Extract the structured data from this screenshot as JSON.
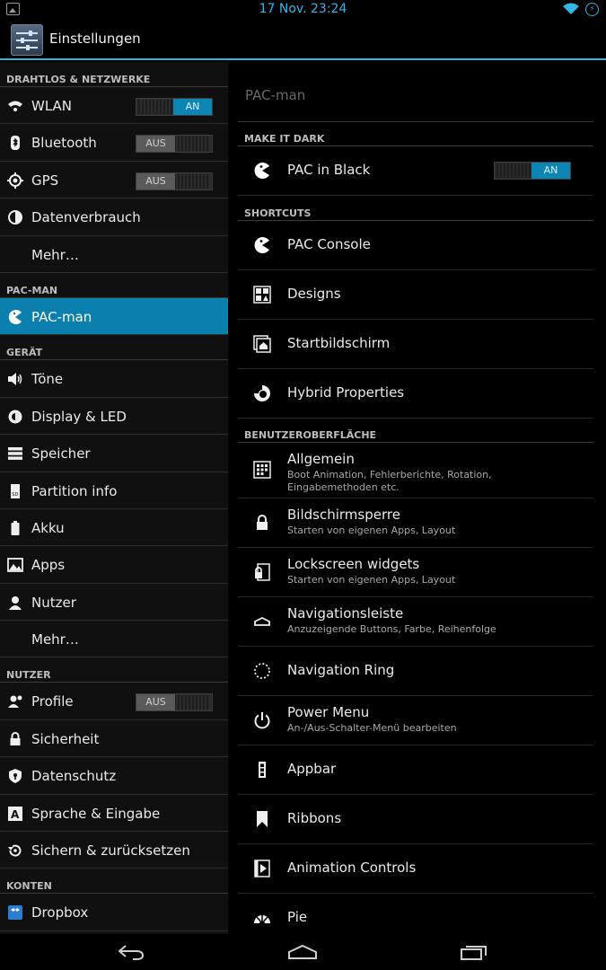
{
  "status_bar": {
    "time": "17 Nov. 23:24"
  },
  "action_bar": {
    "title": "Einstellungen"
  },
  "left": {
    "sections": {
      "wireless": "DRAHTLOS & NETZWERKE",
      "pacman": "PAC-MAN",
      "device": "GERÄT",
      "user": "NUTZER",
      "accounts": "KONTEN"
    },
    "items": {
      "wlan": {
        "label": "WLAN",
        "toggle": "AN"
      },
      "bluetooth": {
        "label": "Bluetooth",
        "toggle": "AUS"
      },
      "gps": {
        "label": "GPS",
        "toggle": "AUS"
      },
      "data_usage": {
        "label": "Datenverbrauch"
      },
      "more1": {
        "label": "Mehr…"
      },
      "pacman": {
        "label": "PAC-man"
      },
      "sounds": {
        "label": "Töne"
      },
      "display": {
        "label": "Display & LED"
      },
      "storage": {
        "label": "Speicher"
      },
      "partition": {
        "label": "Partition info"
      },
      "battery": {
        "label": "Akku"
      },
      "apps": {
        "label": "Apps"
      },
      "users": {
        "label": "Nutzer"
      },
      "more2": {
        "label": "Mehr…"
      },
      "profiles": {
        "label": "Profile",
        "toggle": "AUS"
      },
      "security": {
        "label": "Sicherheit"
      },
      "privacy": {
        "label": "Datenschutz"
      },
      "language": {
        "label": "Sprache & Eingabe"
      },
      "backup": {
        "label": "Sichern & zurücksetzen"
      },
      "dropbox": {
        "label": "Dropbox"
      }
    }
  },
  "right": {
    "title": "PAC-man",
    "sections": {
      "dark": "MAKE IT DARK",
      "shortcuts": "SHORTCUTS",
      "ui": "BENUTZEROBERFLÄCHE"
    },
    "items": {
      "pac_black": {
        "label": "PAC in Black",
        "toggle": "AN"
      },
      "pac_console": {
        "label": "PAC Console"
      },
      "designs": {
        "label": "Designs"
      },
      "homescreen": {
        "label": "Startbildschirm"
      },
      "hybrid": {
        "label": "Hybrid Properties"
      },
      "general": {
        "label": "Allgemein",
        "sub": "Boot Animation, Fehlerberichte, Rotation, Eingabemethoden etc."
      },
      "lockscreen": {
        "label": "Bildschirmsperre",
        "sub": "Starten von eigenen Apps, Layout"
      },
      "lock_widgets": {
        "label": "Lockscreen widgets",
        "sub": "Starten von eigenen Apps, Layout"
      },
      "navbar": {
        "label": "Navigationsleiste",
        "sub": "Anzuzeigende Buttons, Farbe, Reihenfolge"
      },
      "nav_ring": {
        "label": "Navigation Ring"
      },
      "power_menu": {
        "label": "Power Menu",
        "sub": "An-/Aus-Schalter-Menü bearbeiten"
      },
      "appbar": {
        "label": "Appbar"
      },
      "ribbons": {
        "label": "Ribbons"
      },
      "animation": {
        "label": "Animation Controls"
      },
      "pie": {
        "label": "Pie"
      }
    }
  },
  "colors": {
    "accent": "#33b5e5",
    "active_bg": "#0b7fad"
  }
}
